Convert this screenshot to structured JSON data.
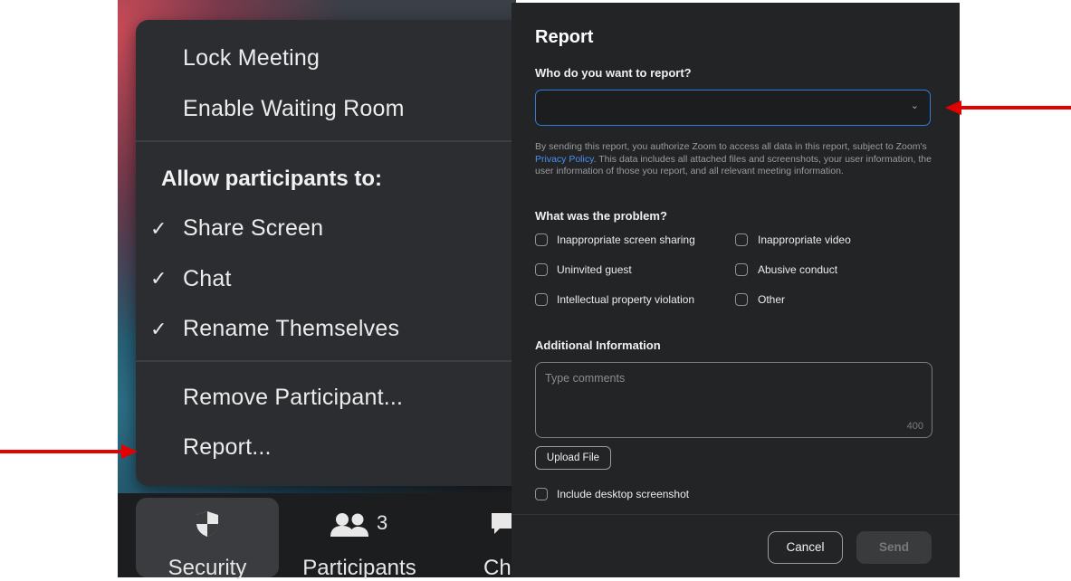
{
  "security_menu": {
    "items_top": [
      "Lock Meeting",
      "Enable Waiting Room"
    ],
    "allow_heading": "Allow participants to:",
    "checked_items": [
      "Share Screen",
      "Chat",
      "Rename Themselves"
    ],
    "check_glyph": "✓",
    "items_bottom": [
      "Remove Participant...",
      "Report..."
    ]
  },
  "toolbar": {
    "security_label": "Security",
    "participants_label": "Participants",
    "participants_count": "3",
    "chat_label_partial": "Ch"
  },
  "report_dialog": {
    "title": "Report",
    "who_label": "Who do you want to report?",
    "who_value": "",
    "legal_text_1": "By sending this report, you authorize Zoom to access all data in this report, subject to Zoom's ",
    "legal_link": "Privacy Policy",
    "legal_text_2": ". This data includes all attached files and screenshots, your user information, the user information of those you report, and all relevant meeting information.",
    "problem_label": "What was the problem?",
    "problems": [
      "Inappropriate screen sharing",
      "Inappropriate video",
      "Uninvited guest",
      "Abusive conduct",
      "Intellectual property violation",
      "Other"
    ],
    "additional_label": "Additional Information",
    "comments_placeholder": "Type comments",
    "char_limit": "400",
    "upload_label": "Upload File",
    "screenshot_label": "Include desktop screenshot",
    "cancel_label": "Cancel",
    "send_label": "Send"
  },
  "colors": {
    "arrow": "#e30000",
    "accent_blue": "#2f7dd8",
    "link": "#4c8ff0",
    "dialog_bg": "#232426",
    "menu_bg": "#2b2d30"
  },
  "icons": [
    "shield-icon",
    "participants-icon",
    "chat-icon",
    "chevron-down-icon",
    "check-icon",
    "arrow-pointer-icon"
  ]
}
